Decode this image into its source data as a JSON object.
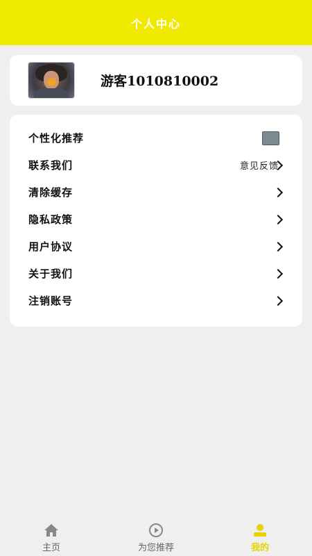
{
  "header": {
    "title": "个人中心"
  },
  "profile": {
    "username": "游客1010810002"
  },
  "menu": {
    "items": [
      {
        "label": "个性化推荐",
        "extra": "",
        "control": "toggle"
      },
      {
        "label": "联系我们",
        "extra": "意见反馈",
        "control": "chevron"
      },
      {
        "label": "清除缓存",
        "extra": "",
        "control": "chevron"
      },
      {
        "label": "隐私政策",
        "extra": "",
        "control": "chevron"
      },
      {
        "label": "用户协议",
        "extra": "",
        "control": "chevron"
      },
      {
        "label": "关于我们",
        "extra": "",
        "control": "chevron"
      },
      {
        "label": "注销账号",
        "extra": "",
        "control": "chevron"
      }
    ]
  },
  "tabbar": {
    "tabs": [
      {
        "label": "主页",
        "icon": "home-icon",
        "active": false
      },
      {
        "label": "为您推荐",
        "icon": "play-circle-icon",
        "active": false
      },
      {
        "label": "我的",
        "icon": "user-icon",
        "active": true
      }
    ]
  },
  "colors": {
    "accent": "#f0ea00",
    "active_tab": "#e6d300",
    "toggle": "#7c8a91",
    "background": "#efefef"
  }
}
